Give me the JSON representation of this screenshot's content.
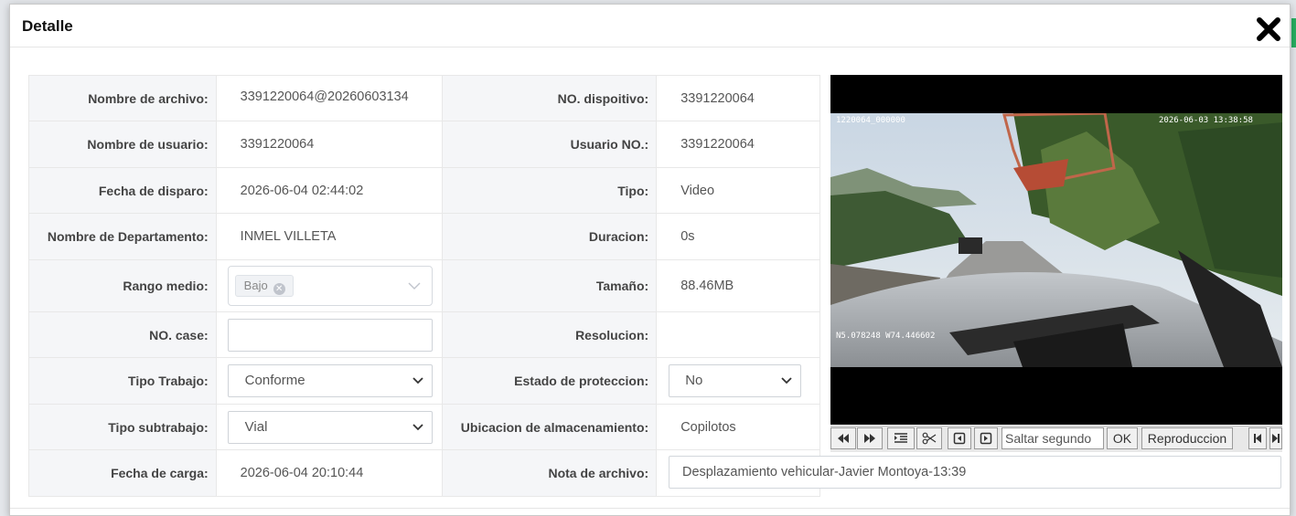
{
  "modal": {
    "title": "Detalle"
  },
  "fields": {
    "file_name": {
      "label": "Nombre de archivo:",
      "value": "3391220064@20260603134"
    },
    "device_no": {
      "label": "NO. dispoitivo:",
      "value": "3391220064"
    },
    "user_name": {
      "label": "Nombre de usuario:",
      "value": "3391220064"
    },
    "user_no": {
      "label": "Usuario NO.:",
      "value": "3391220064"
    },
    "trigger_date": {
      "label": "Fecha de disparo:",
      "value": "2026-06-04 02:44:02"
    },
    "type": {
      "label": "Tipo:",
      "value": "Video"
    },
    "department": {
      "label": "Nombre de Departamento:",
      "value": "INMEL VILLETA"
    },
    "duration": {
      "label": "Duracion:",
      "value": "0s"
    },
    "range": {
      "label": "Rango medio:",
      "tag": "Bajo"
    },
    "size": {
      "label": "Tamaño:",
      "value": "88.46MB"
    },
    "case_no": {
      "label": "NO. case:",
      "value": ""
    },
    "resolution": {
      "label": "Resolucion:",
      "value": ""
    },
    "work_type": {
      "label": "Tipo Trabajo:",
      "value": "Conforme"
    },
    "protection": {
      "label": "Estado de proteccion:",
      "value": "No"
    },
    "sub_work_type": {
      "label": "Tipo subtrabajo:",
      "value": "Vial"
    },
    "storage": {
      "label": "Ubicacion de almacenamiento:",
      "value": "Copilotos"
    },
    "upload_date": {
      "label": "Fecha de carga:",
      "value": "2026-06-04 20:10:44"
    },
    "note": {
      "label": "Nota de archivo:",
      "value": "Desplazamiento vehicular-Javier Montoya-13:39"
    }
  },
  "video": {
    "overlay_id": "1220064_000000",
    "overlay_time": "2026-06-03 13:38:58",
    "overlay_gps": "N5.078248 W74.446602"
  },
  "controls": {
    "seek_placeholder": "Saltar segundo",
    "ok_label": "OK",
    "play_label": "Reproduccion"
  },
  "colors": {
    "accent": "#27ae60",
    "label_bg": "#f5f6f8"
  }
}
